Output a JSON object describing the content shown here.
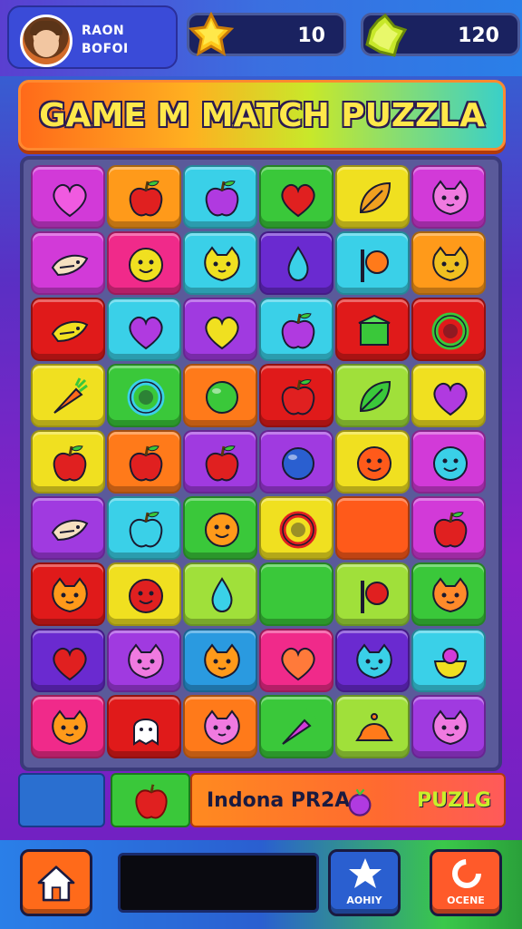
{
  "player": {
    "name_line1": "RAON",
    "name_line2": "BOFOI"
  },
  "counters": [
    {
      "icon": "yellow-star-gem-icon",
      "value": "10"
    },
    {
      "icon": "green-gem-icon",
      "value": "120"
    }
  ],
  "banner": {
    "title": "GAME M MATCH PUZZLA"
  },
  "board": {
    "rows": 9,
    "cols": 6,
    "tiles": [
      [
        {
          "bg": "#d23ad8",
          "icon": "heart",
          "c": "#f05ae0"
        },
        {
          "bg": "#ff9a1a",
          "icon": "apple",
          "c": "#e02020"
        },
        {
          "bg": "#3ad0e8",
          "icon": "apple",
          "c": "#b03ae0"
        },
        {
          "bg": "#3ac83a",
          "icon": "heart",
          "c": "#e02020"
        },
        {
          "bg": "#f0e020",
          "icon": "leaf",
          "c": "#f0a020"
        },
        {
          "bg": "#d23ad8",
          "icon": "cat",
          "c": "#f07ae0"
        }
      ],
      [
        {
          "bg": "#d23ad8",
          "icon": "fish",
          "c": "#f5e0c0"
        },
        {
          "bg": "#f02a8a",
          "icon": "face",
          "c": "#f0e020"
        },
        {
          "bg": "#3ad0e8",
          "icon": "cat",
          "c": "#f0e020"
        },
        {
          "bg": "#6a2ad0",
          "icon": "drop",
          "c": "#3ad0e8"
        },
        {
          "bg": "#3ad0e8",
          "icon": "flag",
          "c": "#ff7a1a"
        },
        {
          "bg": "#ff9a1a",
          "icon": "cat",
          "c": "#f0c020"
        }
      ],
      [
        {
          "bg": "#e01a1a",
          "icon": "fish",
          "c": "#f0e020"
        },
        {
          "bg": "#3ad0e8",
          "icon": "heart",
          "c": "#b03ae0"
        },
        {
          "bg": "#a03ae0",
          "icon": "heart",
          "c": "#f0e020"
        },
        {
          "bg": "#3ad0e8",
          "icon": "apple",
          "c": "#b03ae0"
        },
        {
          "bg": "#e01a1a",
          "icon": "box",
          "c": "#3ac83a"
        },
        {
          "bg": "#e01a1a",
          "icon": "ring",
          "c": "#3ac83a"
        }
      ],
      [
        {
          "bg": "#f0e020",
          "icon": "carrot",
          "c": "#ff6a1a"
        },
        {
          "bg": "#3ac83a",
          "icon": "ring",
          "c": "#3ad0e8"
        },
        {
          "bg": "#ff7a1a",
          "icon": "ball",
          "c": "#3ac83a"
        },
        {
          "bg": "#e01a1a",
          "icon": "apple",
          "c": "#e02020"
        },
        {
          "bg": "#a0e03a",
          "icon": "leaf",
          "c": "#3ac83a"
        },
        {
          "bg": "#f0e020",
          "icon": "heart",
          "c": "#b03ae0"
        }
      ],
      [
        {
          "bg": "#f0e020",
          "icon": "apple",
          "c": "#e02020"
        },
        {
          "bg": "#ff7a1a",
          "icon": "apple",
          "c": "#e02020"
        },
        {
          "bg": "#a03ae0",
          "icon": "apple",
          "c": "#e02020"
        },
        {
          "bg": "#a03ae0",
          "icon": "ball",
          "c": "#2a5fd0"
        },
        {
          "bg": "#f0e020",
          "icon": "face",
          "c": "#ff5a1a"
        },
        {
          "bg": "#d23ad8",
          "icon": "face",
          "c": "#3ad0e8"
        }
      ],
      [
        {
          "bg": "#a03ae0",
          "icon": "fish",
          "c": "#f5e0c0"
        },
        {
          "bg": "#3ad0e8",
          "icon": "apple",
          "c": "#3ad0e8"
        },
        {
          "bg": "#3ac83a",
          "icon": "face",
          "c": "#ff9a1a"
        },
        {
          "bg": "#f0e020",
          "icon": "ring",
          "c": "#e02020"
        },
        {
          "bg": "#ff5a1a",
          "icon": "none",
          "c": "#ff5a1a"
        },
        {
          "bg": "#d23ad8",
          "icon": "apple",
          "c": "#e02020"
        }
      ],
      [
        {
          "bg": "#e01a1a",
          "icon": "cat",
          "c": "#ff9a1a"
        },
        {
          "bg": "#f0e020",
          "icon": "face",
          "c": "#e02020"
        },
        {
          "bg": "#a0e03a",
          "icon": "drop",
          "c": "#3ad0e8"
        },
        {
          "bg": "#3ac83a",
          "icon": "none",
          "c": "#3ac83a"
        },
        {
          "bg": "#a0e03a",
          "icon": "flag",
          "c": "#e02020"
        },
        {
          "bg": "#3ac83a",
          "icon": "cat",
          "c": "#ff8a2a"
        }
      ],
      [
        {
          "bg": "#6a2ad0",
          "icon": "heart",
          "c": "#e02020"
        },
        {
          "bg": "#a03ae0",
          "icon": "cat",
          "c": "#f07ae0"
        },
        {
          "bg": "#2a9ae0",
          "icon": "cat",
          "c": "#ff9a1a"
        },
        {
          "bg": "#f02a8a",
          "icon": "heart",
          "c": "#ff7a3a"
        },
        {
          "bg": "#6a2ad0",
          "icon": "cat",
          "c": "#3ad0e8"
        },
        {
          "bg": "#3ad0e8",
          "icon": "bowl",
          "c": "#f0e020"
        }
      ],
      [
        {
          "bg": "#f02a8a",
          "icon": "cat",
          "c": "#ff9a1a"
        },
        {
          "bg": "#e01a1a",
          "icon": "ghost",
          "c": "#ffffff"
        },
        {
          "bg": "#ff7a1a",
          "icon": "cat",
          "c": "#f07ae0"
        },
        {
          "bg": "#3ac83a",
          "icon": "carrot",
          "c": "#d23ad8"
        },
        {
          "bg": "#a0e03a",
          "icon": "hat",
          "c": "#ff7a1a"
        },
        {
          "bg": "#a03ae0",
          "icon": "cat",
          "c": "#f07ae0"
        }
      ]
    ]
  },
  "strip": {
    "label_left": "Indona PR2A",
    "label_right": "PUZLG"
  },
  "nav": {
    "star_label": "AOHIY",
    "done_label": "OCENE"
  },
  "colors": {
    "accent": "#ff6a1a",
    "title_text": "#ffe84a"
  }
}
